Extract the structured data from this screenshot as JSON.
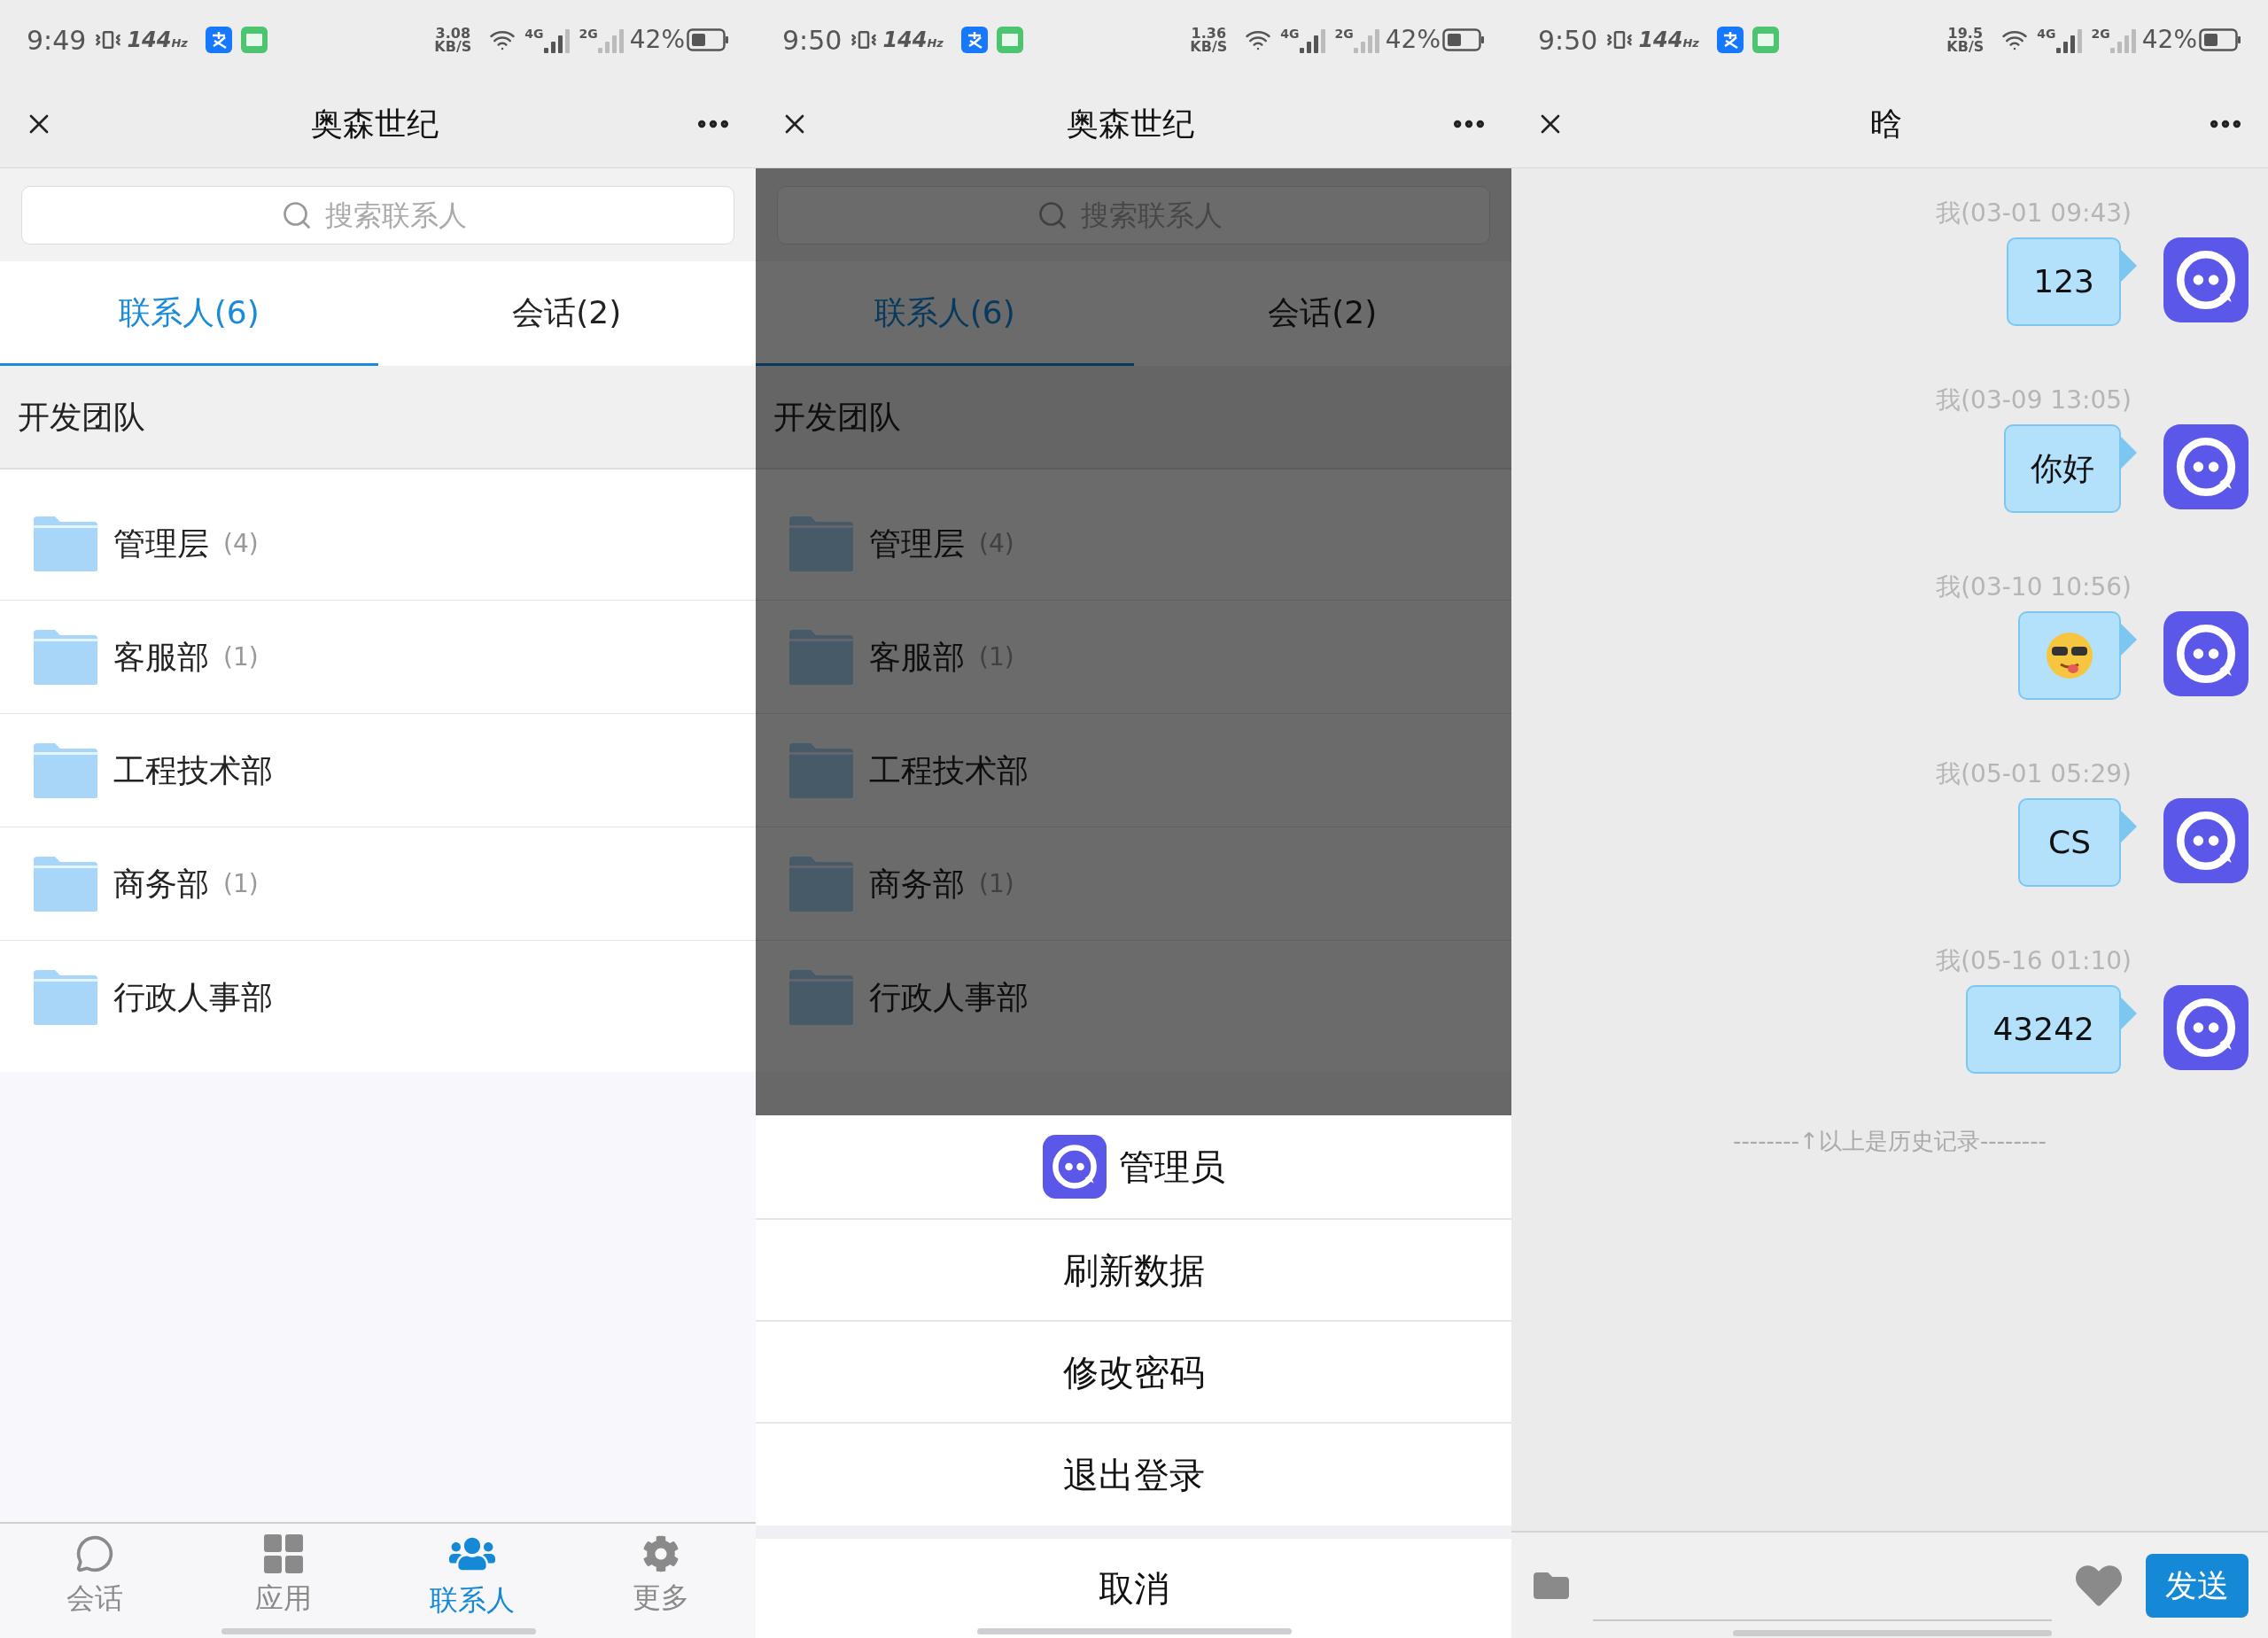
{
  "screens": [
    {
      "kind": "contacts",
      "status_bar": {
        "time": "9:49",
        "refresh": "144",
        "refresh_unit": "Hz",
        "speed": "3.08",
        "speed_unit": "KB/S",
        "net_1": "4G",
        "net_2": "2G",
        "battery": "42%"
      },
      "nav": {
        "title": "奥森世纪"
      },
      "search": {
        "placeholder": "搜索联系人"
      },
      "tabs": [
        {
          "label": "联系人(6)",
          "selected": true
        },
        {
          "label": "会话(2)",
          "selected": false
        }
      ],
      "group": "开发团队",
      "folders": [
        {
          "name": "管理层",
          "count": "(4)"
        },
        {
          "name": "客服部",
          "count": "(1)"
        },
        {
          "name": "工程技术部"
        },
        {
          "name": "商务部",
          "count": "(1)"
        },
        {
          "name": "行政人事部"
        }
      ],
      "bottom_nav": [
        {
          "kind": "chat",
          "label": "会话",
          "selected": false
        },
        {
          "kind": "apps",
          "label": "应用",
          "selected": false
        },
        {
          "kind": "contacts",
          "label": "联系人",
          "selected": true
        },
        {
          "kind": "more",
          "label": "更多",
          "selected": false
        }
      ]
    },
    {
      "kind": "contacts",
      "status_bar": {
        "time": "9:50",
        "refresh": "144",
        "refresh_unit": "Hz",
        "speed": "1.36",
        "speed_unit": "KB/S",
        "net_1": "4G",
        "net_2": "2G",
        "battery": "42%"
      },
      "nav": {
        "title": "奥森世纪"
      },
      "search": {
        "placeholder": "搜索联系人"
      },
      "tabs": [
        {
          "label": "联系人(6)",
          "selected": true
        },
        {
          "label": "会话(2)",
          "selected": false
        }
      ],
      "group": "开发团队",
      "folders": [
        {
          "name": "管理层",
          "count": "(4)"
        },
        {
          "name": "客服部",
          "count": "(1)"
        },
        {
          "name": "工程技术部"
        },
        {
          "name": "商务部",
          "count": "(1)"
        },
        {
          "name": "行政人事部"
        }
      ],
      "action_sheet": {
        "user": "管理员",
        "actions": [
          "刷新数据",
          "修改密码",
          "退出登录"
        ],
        "cancel": "取消"
      }
    },
    {
      "kind": "chat",
      "status_bar": {
        "time": "9:50",
        "refresh": "144",
        "refresh_unit": "Hz",
        "speed": "19.5",
        "speed_unit": "KB/S",
        "net_1": "4G",
        "net_2": "2G",
        "battery": "42%"
      },
      "nav": {
        "title": "晗"
      },
      "messages": [
        {
          "kind": "text",
          "time": "我(03-01 09:43)",
          "text": "123"
        },
        {
          "kind": "text",
          "time": "我(03-09 13:05)",
          "text": "你好"
        },
        {
          "kind": "emoji",
          "time": "我(03-10 10:56)"
        },
        {
          "kind": "text",
          "time": "我(05-01 05:29)",
          "text": "CS"
        },
        {
          "kind": "text",
          "time": "我(05-16 01:10)",
          "text": "43242"
        }
      ],
      "history_note": "--------↑以上是历史记录--------",
      "composer": {
        "send": "发送"
      }
    }
  ]
}
